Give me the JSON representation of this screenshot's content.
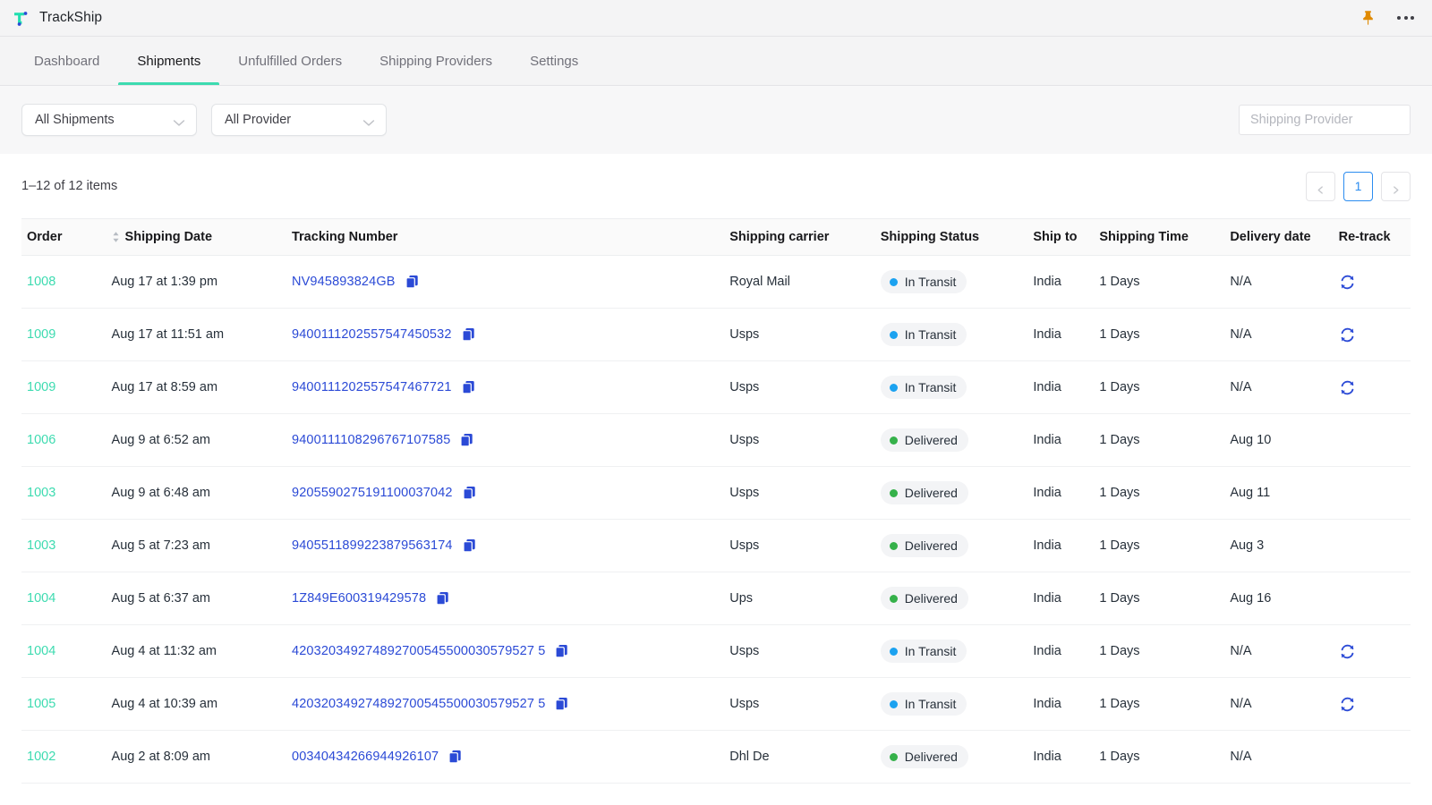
{
  "app": {
    "brand_name": "TrackShip",
    "logo_icon": "trackship-logo-icon",
    "pin_icon": "pin-icon",
    "more_icon": "kebab-menu-icon"
  },
  "tabs": [
    {
      "label": "Dashboard",
      "active": false
    },
    {
      "label": "Shipments",
      "active": true
    },
    {
      "label": "Unfulfilled Orders",
      "active": false
    },
    {
      "label": "Shipping Providers",
      "active": false
    },
    {
      "label": "Settings",
      "active": false
    }
  ],
  "filters": {
    "shipments_select": {
      "value": "All Shipments",
      "chevron_icon": "chevron-down-icon"
    },
    "provider_select": {
      "value": "All Provider",
      "chevron_icon": "chevron-down-icon"
    },
    "search": {
      "value": "",
      "placeholder": "Shipping Provider"
    }
  },
  "list": {
    "items_count": "1–12 of 12 items",
    "pagination": {
      "prev_icon": "chevron-left-icon",
      "current_page": "1",
      "next_icon": "chevron-right-icon"
    }
  },
  "table": {
    "columns": [
      "Order",
      "Shipping Date",
      "Tracking Number",
      "Shipping carrier",
      "Shipping Status",
      "Ship to",
      "Shipping Time",
      "Delivery date",
      "Re-track"
    ],
    "sort_icon": "sort-arrows-icon",
    "copy_icon": "copy-icon",
    "retrack_icon": "refresh-sync-icon",
    "rows": [
      {
        "order": "1008",
        "shipping_date": "Aug 17 at 1:39 pm",
        "tracking_number": "NV945893824GB",
        "carrier": "Royal Mail",
        "status": "In Transit",
        "status_type": "transit",
        "ship_to": "India",
        "shipping_time": "1 Days",
        "delivery_date": "N/A",
        "retrack": true
      },
      {
        "order": "1009",
        "shipping_date": "Aug 17 at 11:51 am",
        "tracking_number": "9400111202557547450532",
        "carrier": "Usps",
        "status": "In Transit",
        "status_type": "transit",
        "ship_to": "India",
        "shipping_time": "1 Days",
        "delivery_date": "N/A",
        "retrack": true
      },
      {
        "order": "1009",
        "shipping_date": "Aug 17 at 8:59 am",
        "tracking_number": "9400111202557547467721",
        "carrier": "Usps",
        "status": "In Transit",
        "status_type": "transit",
        "ship_to": "India",
        "shipping_time": "1 Days",
        "delivery_date": "N/A",
        "retrack": true
      },
      {
        "order": "1006",
        "shipping_date": "Aug 9 at 6:52 am",
        "tracking_number": "9400111108296767107585",
        "carrier": "Usps",
        "status": "Delivered",
        "status_type": "delivered",
        "ship_to": "India",
        "shipping_time": "1 Days",
        "delivery_date": "Aug 10",
        "retrack": false
      },
      {
        "order": "1003",
        "shipping_date": "Aug 9 at 6:48 am",
        "tracking_number": "9205590275191100037042",
        "carrier": "Usps",
        "status": "Delivered",
        "status_type": "delivered",
        "ship_to": "India",
        "shipping_time": "1 Days",
        "delivery_date": "Aug 11",
        "retrack": false
      },
      {
        "order": "1003",
        "shipping_date": "Aug 5 at 7:23 am",
        "tracking_number": "9405511899223879563174",
        "carrier": "Usps",
        "status": "Delivered",
        "status_type": "delivered",
        "ship_to": "India",
        "shipping_time": "1 Days",
        "delivery_date": "Aug 3",
        "retrack": false
      },
      {
        "order": "1004",
        "shipping_date": "Aug 5 at 6:37 am",
        "tracking_number": "1Z849E600319429578",
        "carrier": "Ups",
        "status": "Delivered",
        "status_type": "delivered",
        "ship_to": "India",
        "shipping_time": "1 Days",
        "delivery_date": "Aug 16",
        "retrack": false
      },
      {
        "order": "1004",
        "shipping_date": "Aug 4 at 11:32 am",
        "tracking_number": "420320349274892700545500030579527 5",
        "carrier": "Usps",
        "status": "In Transit",
        "status_type": "transit",
        "ship_to": "India",
        "shipping_time": "1 Days",
        "delivery_date": "N/A",
        "retrack": true
      },
      {
        "order": "1005",
        "shipping_date": "Aug 4 at 10:39 am",
        "tracking_number": "420320349274892700545500030579527 5",
        "carrier": "Usps",
        "status": "In Transit",
        "status_type": "transit",
        "ship_to": "India",
        "shipping_time": "1 Days",
        "delivery_date": "N/A",
        "retrack": true
      },
      {
        "order": "1002",
        "shipping_date": "Aug 2 at 8:09 am",
        "tracking_number": "00340434266944926107",
        "carrier": "Dhl De",
        "status": "Delivered",
        "status_type": "delivered",
        "ship_to": "India",
        "shipping_time": "1 Days",
        "delivery_date": "N/A",
        "retrack": false
      }
    ]
  },
  "colors": {
    "brand_teal": "#3ddbb0",
    "link_blue": "#2b4ad6",
    "accent_blue": "#2b8cf0",
    "status_transit": "#1ba2f0",
    "status_delivered": "#35b14a",
    "pin_orange": "#e08a00"
  }
}
